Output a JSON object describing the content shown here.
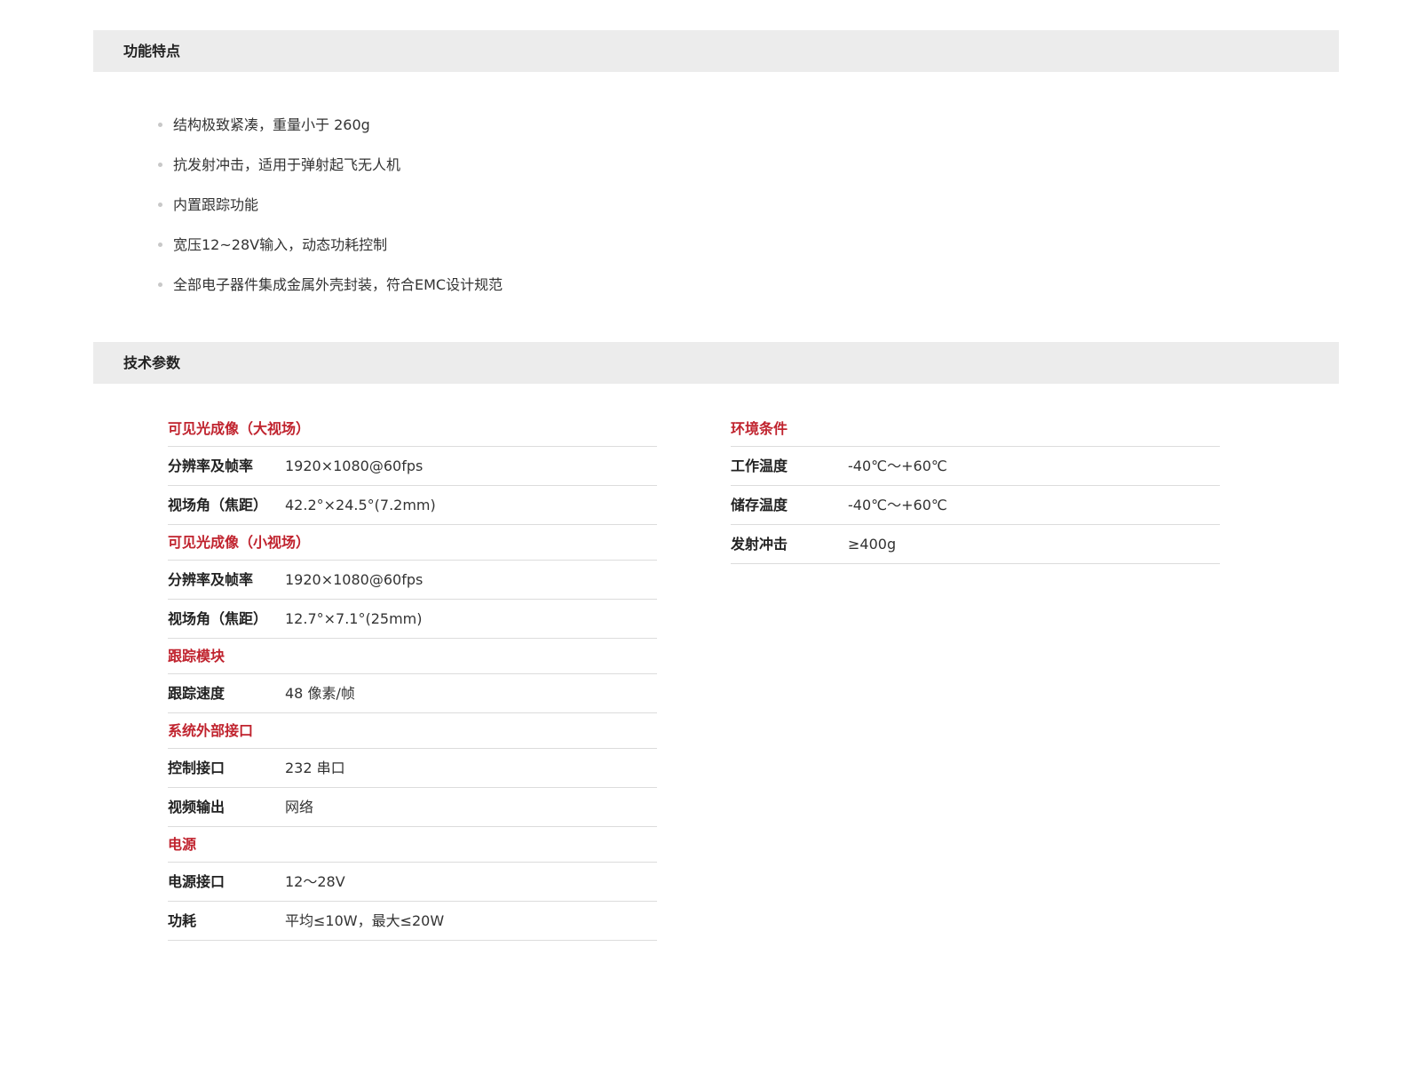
{
  "features": {
    "title": "功能特点",
    "items": [
      "结构极致紧凑，重量小于 260g",
      "抗发射冲击，适用于弹射起飞无人机",
      "内置跟踪功能",
      "宽压12~28V输入，动态功耗控制",
      "全部电子器件集成金属外壳封装，符合EMC设计规范"
    ]
  },
  "specs": {
    "title": "技术参数",
    "left": {
      "visible_wide": {
        "title": "可见光成像（大视场）",
        "rows": [
          {
            "k": "分辨率及帧率",
            "v": "1920×1080@60fps"
          },
          {
            "k": "视场角（焦距）",
            "v": "42.2°×24.5°(7.2mm)"
          }
        ]
      },
      "visible_narrow": {
        "title": "可见光成像（小视场）",
        "rows": [
          {
            "k": "分辨率及帧率",
            "v": "1920×1080@60fps"
          },
          {
            "k": "视场角（焦距）",
            "v": "12.7°×7.1°(25mm)"
          }
        ]
      },
      "tracking": {
        "title": "跟踪模块",
        "rows": [
          {
            "k": "跟踪速度",
            "v": "48 像素/帧"
          }
        ]
      },
      "interface": {
        "title": "系统外部接口",
        "rows": [
          {
            "k": "控制接口",
            "v": "232 串口"
          },
          {
            "k": "视频输出",
            "v": "网络"
          }
        ]
      },
      "power": {
        "title": "电源",
        "rows": [
          {
            "k": "电源接口",
            "v": "12～28V"
          },
          {
            "k": "功耗",
            "v": "平均≤10W，最大≤20W"
          }
        ]
      }
    },
    "right": {
      "environment": {
        "title": "环境条件",
        "rows": [
          {
            "k": "工作温度",
            "v": "-40℃～+60℃"
          },
          {
            "k": "储存温度",
            "v": "-40℃～+60℃"
          },
          {
            "k": "发射冲击",
            "v": "≥400g"
          }
        ]
      }
    }
  },
  "colors": {
    "accent": "#c0232e",
    "header_bg": "#ececec",
    "divider": "#dcdcdc"
  }
}
